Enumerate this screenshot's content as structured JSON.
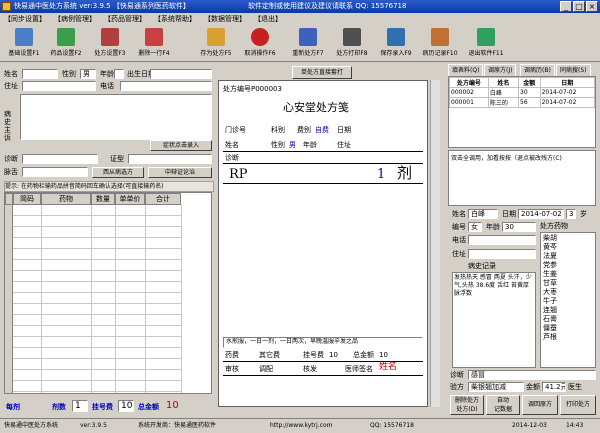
{
  "titlebar": {
    "title": "快易通中医处方系统  ver:3.9.5 【快易通系列医药软件】",
    "right": "软件定制或使用建议及建议请联系 QQ: 15576718"
  },
  "menu": [
    "【同步设置】",
    "【病例管理】",
    "【药品管理】",
    "【系统帮助】",
    "【数据管理】",
    "【退出】"
  ],
  "toolbar": {
    "buttons": [
      {
        "label": "基础设置F1",
        "color": "#4a7ec8"
      },
      {
        "label": "药品设置F2",
        "color": "#3a9e4a"
      },
      {
        "label": "处方设置F3",
        "color": "#b04040"
      },
      {
        "label": "删除一行F4",
        "color": "#c84040"
      },
      {
        "label": "存为处方F5",
        "color": "#d8a030"
      },
      {
        "label": "取消操作F6",
        "color": "#c82020"
      },
      {
        "label": "重新处方F7",
        "color": "#4060c0"
      },
      {
        "label": "处方打印F8",
        "color": "#505050"
      },
      {
        "label": "保存录入F9",
        "color": "#3070b0"
      },
      {
        "label": "病历记录F10",
        "color": "#c07030"
      },
      {
        "label": "退出软件F11",
        "color": "#30a060"
      }
    ]
  },
  "patient": {
    "name_label": "姓名",
    "sex_label": "性别",
    "sex_value": "男",
    "age_label": "年龄",
    "birth_label": "出生日期",
    "address_label": "住址",
    "phone_label": "电话",
    "complaint_label": "病史主诉",
    "symptom_btn": "症状点击录入",
    "diagnosis_label": "诊断",
    "syndrome_label": "证型",
    "pulse_label": "脉舌",
    "pulse_btn": "西从病选方",
    "tips_btn": "中辩证论治"
  },
  "hint": "提示: 在药物栏输药品拼音简码回车确认选择(可直接输药名)",
  "grid": {
    "headers": [
      "简码",
      "药物",
      "数量",
      "单单价",
      "合计"
    ]
  },
  "footer": {
    "label1": "每剂",
    "label2": "剂数",
    "doses_value": "1",
    "label3": "挂号费",
    "fee_value": "10",
    "label4": "总金额",
    "total_value": "10"
  },
  "paper": {
    "print_btn": "单处方直接套打",
    "number_label": "处方编号",
    "number_value": "P000003",
    "clinic_title": "心安堂处方笺",
    "row1": [
      "门诊号",
      "科别",
      "费别",
      "自费",
      "日期"
    ],
    "row2": [
      "姓名",
      "性别",
      "男",
      "年龄",
      "住址"
    ],
    "diag": "诊断",
    "rp": "RP",
    "dose_num": "1",
    "dose_unit": "剂",
    "usage": "水煎服，一日一剂，一日两次，早晚温服辛发之品",
    "bottom1": [
      "药费",
      "其它费",
      "挂号费",
      "10",
      "总金额",
      "10"
    ],
    "bottom2": [
      "审核",
      "调配",
      "核发",
      "医师签名",
      "姓名"
    ]
  },
  "right": {
    "tabs": [
      "填表料(Q)",
      "调原方(J)",
      "调病历(B)",
      "同病搜(S)"
    ],
    "table_headers": [
      "处方编号",
      "姓名",
      "金额",
      "日期"
    ],
    "rows": [
      [
        "000002",
        "白峰",
        "30",
        "2014-07-02"
      ],
      [
        "000001",
        "陈三的",
        "56",
        "2014-07-02"
      ]
    ],
    "hint": "双击全调用，加看按按（退点被改残方(C)",
    "name_label": "姓名",
    "name_value": "白峰",
    "date_label": "日期",
    "date_value": "2014-07-02",
    "age_value": "3",
    "age_unit": "岁",
    "gender_label": "编号",
    "gender_value": "女",
    "age_label": "年龄",
    "age_value2": "30",
    "phone_label": "电话",
    "address_label": "住址",
    "history_label": "病史记录",
    "history_text": "发热热天  感冒  两夏 头汗，少气,头热 38.6度 舌红 苔黄厚 脉浮数",
    "herbs_label": "处方药物",
    "herbs": [
      "柴胡",
      "黄芩",
      "法夏",
      "党参",
      "生姜",
      "甘草",
      "大枣",
      "牛子",
      "连翘",
      "石膏",
      "僵蚕",
      "芦根"
    ],
    "diag_label": "诊断",
    "diag_value": "感冒",
    "usage_label": "验方",
    "usage_value": "柴银翘加减",
    "amount_label": "金额",
    "amount_value": "41.2元",
    "doctor_label": "医生",
    "doctor_value": "姓名",
    "delete_btn": "删除处方",
    "delete_btn2": "处方(D)",
    "callback_btn": "调回原方",
    "record_btn": "自动",
    "record_btn2": "记数据",
    "print_btn": "打印处方"
  },
  "status": {
    "app": "快易通中医处方系统",
    "ver": "ver:3.9.5",
    "support": "系统开发商：快易通医药软件",
    "url": "http://www.kytrj.com",
    "qq": "QQ: 15576718",
    "date": "2014-12-03",
    "time": "14:43"
  }
}
